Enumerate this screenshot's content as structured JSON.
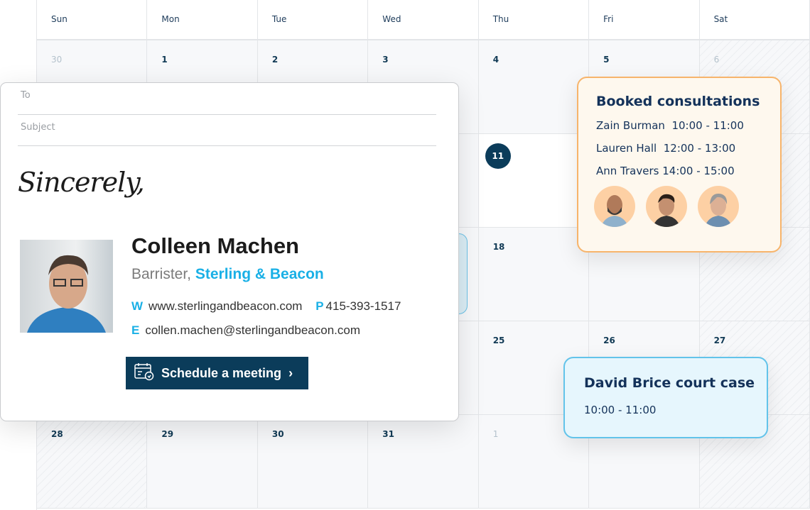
{
  "calendar": {
    "weekdays": [
      "Sun",
      "Mon",
      "Tue",
      "Wed",
      "Thu",
      "Fri",
      "Sat"
    ],
    "weeks": [
      [
        {
          "day": "30",
          "muted": true
        },
        {
          "day": "1"
        },
        {
          "day": "2"
        },
        {
          "day": "3"
        },
        {
          "day": "4"
        },
        {
          "day": "5"
        },
        {
          "day": "6",
          "muted": true,
          "hatch": true
        }
      ],
      [
        {
          "day": ""
        },
        {
          "day": ""
        },
        {
          "day": ""
        },
        {
          "day": ""
        },
        {
          "day": "11",
          "today": true
        },
        {
          "day": ""
        },
        {
          "day": "",
          "hatch": true
        }
      ],
      [
        {
          "day": ""
        },
        {
          "day": ""
        },
        {
          "day": ""
        },
        {
          "day": ""
        },
        {
          "day": "18"
        },
        {
          "day": ""
        },
        {
          "day": "",
          "hatch": true
        }
      ],
      [
        {
          "day": ""
        },
        {
          "day": ""
        },
        {
          "day": ""
        },
        {
          "day": ""
        },
        {
          "day": "25"
        },
        {
          "day": "26"
        },
        {
          "day": "27",
          "hatch": true
        }
      ],
      [
        {
          "day": "28",
          "hatch": true
        },
        {
          "day": "29"
        },
        {
          "day": "30"
        },
        {
          "day": "31"
        },
        {
          "day": "1",
          "muted": true
        },
        {
          "day": ""
        },
        {
          "day": "",
          "hatch": true
        }
      ]
    ]
  },
  "email": {
    "to_placeholder": "To",
    "subject_placeholder": "Subject",
    "signoff": "Sincerely,",
    "name": "Colleen Machen",
    "role": "Barrister,",
    "company": "Sterling & Beacon",
    "web_label": "W",
    "web": "www.sterlingandbeacon.com",
    "phone_label": "P",
    "phone": "415-393-1517",
    "email_label": "E",
    "email": "collen.machen@sterlingandbeacon.com",
    "button": "Schedule a meeting"
  },
  "booked": {
    "title": "Booked consultations",
    "items": [
      {
        "name": "Zain Burman",
        "time": "10:00 - 11:00"
      },
      {
        "name": "Lauren Hall",
        "time": "12:00 - 13:00"
      },
      {
        "name": "Ann Travers",
        "time": "14:00 - 15:00"
      }
    ]
  },
  "court": {
    "title": "David Brice court case",
    "time": "10:00 - 11:00"
  },
  "colors": {
    "navy": "#0b3c5a",
    "accent": "#1ab0e6",
    "booked_border": "#f7b46b",
    "court_border": "#62c3ea"
  }
}
